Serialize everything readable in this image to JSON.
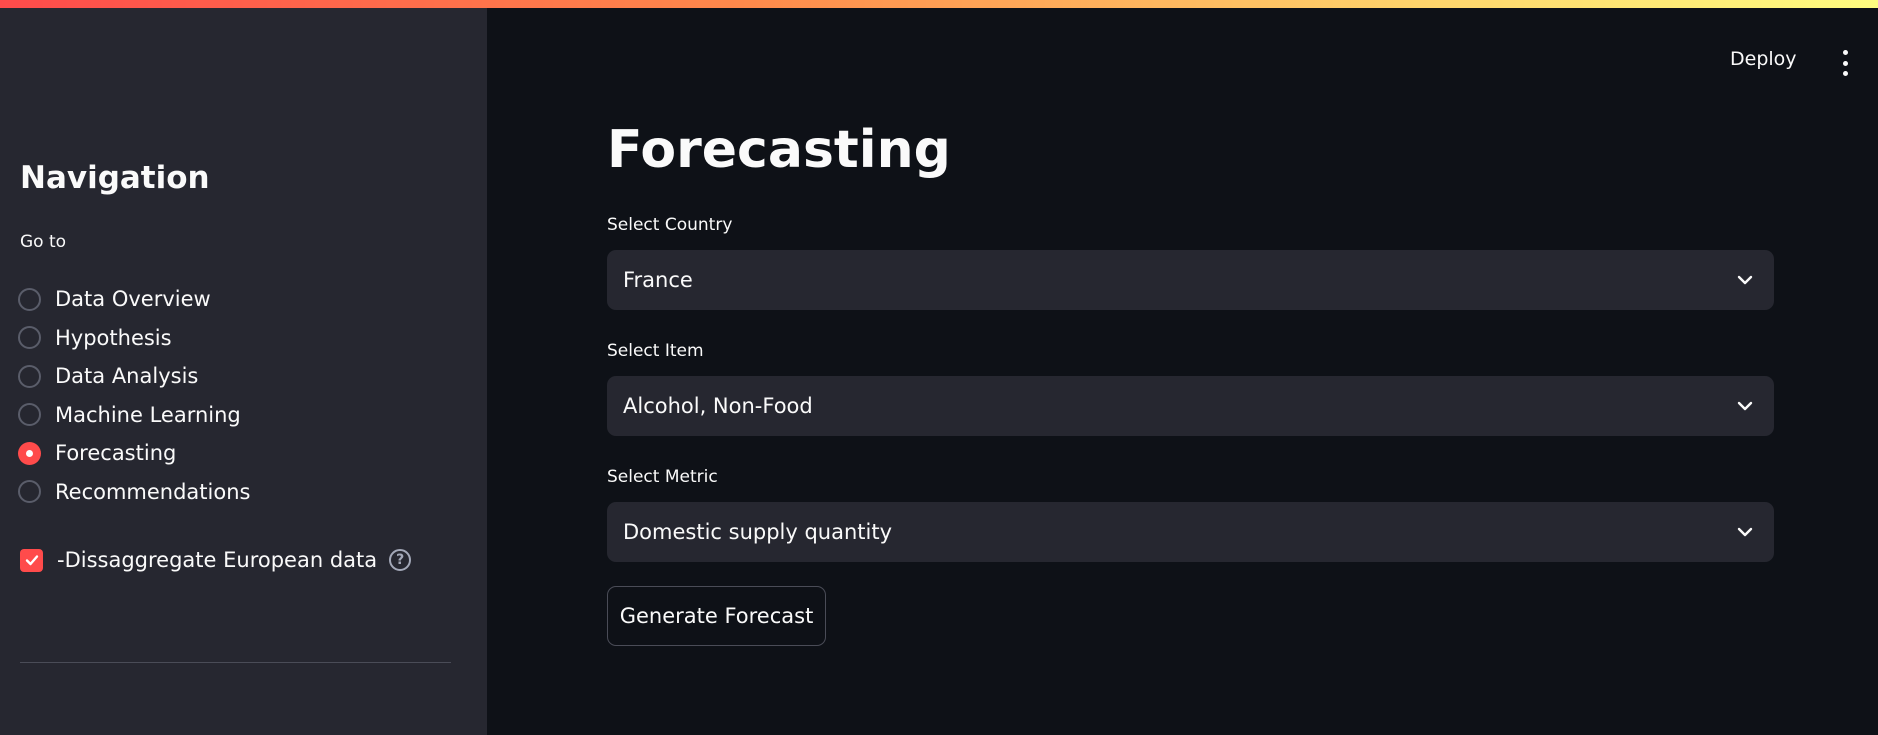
{
  "header": {
    "deploy_label": "Deploy",
    "menu_icon": "more-vertical-icon"
  },
  "sidebar": {
    "title": "Navigation",
    "radio_group_label": "Go to",
    "items": [
      {
        "label": "Data Overview",
        "selected": false
      },
      {
        "label": "Hypothesis",
        "selected": false
      },
      {
        "label": "Data Analysis",
        "selected": false
      },
      {
        "label": "Machine Learning",
        "selected": false
      },
      {
        "label": "Forecasting",
        "selected": true
      },
      {
        "label": "Recommendations",
        "selected": false
      }
    ],
    "checkbox": {
      "label": "-Dissaggregate European data",
      "checked": true,
      "help_icon": "help-circle-icon"
    }
  },
  "main": {
    "title": "Forecasting",
    "fields": [
      {
        "label": "Select Country",
        "value": "France"
      },
      {
        "label": "Select Item",
        "value": "Alcohol, Non-Food"
      },
      {
        "label": "Select Metric",
        "value": "Domestic supply quantity"
      }
    ],
    "button_label": "Generate Forecast"
  },
  "colors": {
    "accent": "#ff4b4b",
    "background": "#0e1117",
    "sidebar_background": "#262730",
    "input_background": "#262730"
  }
}
